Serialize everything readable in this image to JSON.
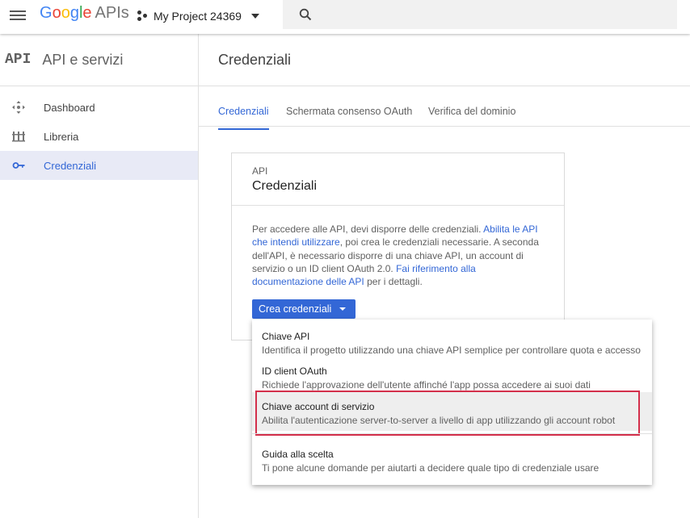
{
  "topbar": {
    "logo_google": "Google",
    "logo_apis": "APIs",
    "project_name": "My Project 24369"
  },
  "sidebar": {
    "api_label": "API",
    "title": "API e servizi",
    "items": [
      {
        "label": "Dashboard",
        "icon": "dashboard-icon"
      },
      {
        "label": "Libreria",
        "icon": "library-icon"
      },
      {
        "label": "Credenziali",
        "icon": "key-icon",
        "active": true
      }
    ]
  },
  "main": {
    "title": "Credenziali",
    "tabs": [
      {
        "label": "Credenziali",
        "active": true
      },
      {
        "label": "Schermata consenso OAuth"
      },
      {
        "label": "Verifica del dominio"
      }
    ]
  },
  "card": {
    "small_title": "API",
    "title": "Credenziali",
    "body": {
      "t1": "Per accedere alle API, devi disporre delle credenziali. ",
      "link1": "Abilita le API che intendi utilizzare",
      "t2": ", poi crea le credenziali necessarie. A seconda dell'API, è necessario disporre di una chiave API, un account di servizio o un ID client OAuth 2.0. ",
      "link2": "Fai riferimento alla documentazione delle API",
      "t3": " per i dettagli."
    },
    "button_label": "Crea credenziali"
  },
  "menu": {
    "items": [
      {
        "label": "Chiave API",
        "desc": "Identifica il progetto utilizzando una chiave API semplice per controllare quota e accesso"
      },
      {
        "label": "ID client OAuth",
        "desc": "Richiede l'approvazione dell'utente affinché l'app possa accedere ai suoi dati"
      },
      {
        "label": "Chiave account di servizio",
        "desc": "Abilita l'autenticazione server-to-server a livello di app utilizzando gli account robot"
      },
      {
        "label": "Guida alla scelta",
        "desc": "Ti pone alcune domande per aiutarti a decidere quale tipo di credenziale usare"
      }
    ]
  },
  "colors": {
    "accent": "#3367d6",
    "highlight_box": "#d32f4b"
  }
}
